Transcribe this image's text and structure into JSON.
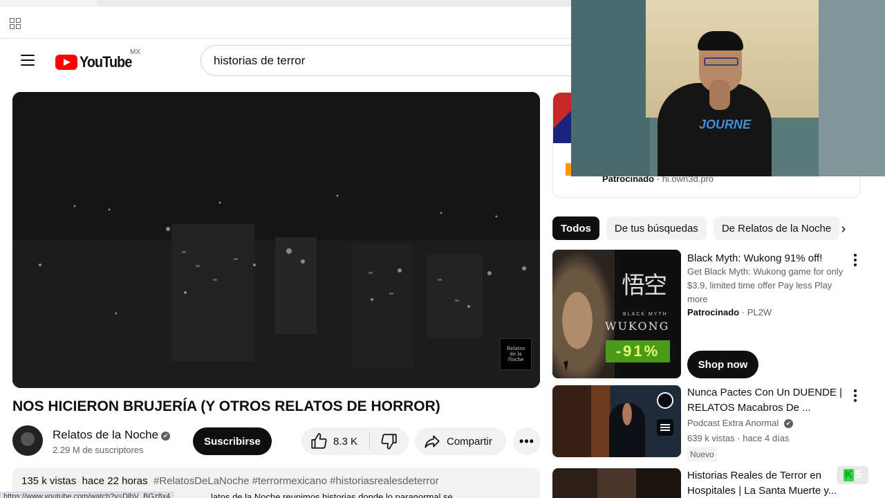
{
  "header": {
    "logo_text": "YouTube",
    "country_code": "MX",
    "search_value": "historias de terror"
  },
  "video": {
    "title": "NOS HICIERON BRUJERÍA (Y OTROS RELATOS DE HORROR)",
    "channel_name": "Relatos de la Noche",
    "verified_mark": "✔",
    "subscribers": "2.29 M de suscriptores",
    "subscribe_label": "Suscribirse",
    "likes": "8.3 K",
    "share_label": "Compartir",
    "more_label": "•••",
    "views": "135 k vistas",
    "age": "hace 22 horas",
    "hashtags": "#RelatosDeLaNoche #terrormexicano #historiasrealesdeterror",
    "status_url": "https://www.youtube.com/watch?v=DlbV_BGz8x4",
    "description_fragment": "latos de la Noche reunimos historias donde lo paranormal se"
  },
  "ad_top": {
    "sponsored_label": "Patrocinado",
    "domain": "hi.own3d.pro"
  },
  "chips": [
    {
      "label": "Todos",
      "active": true
    },
    {
      "label": "De tus búsquedas",
      "active": false
    },
    {
      "label": "De Relatos de la Noche",
      "active": false
    }
  ],
  "recommendations": {
    "ad": {
      "title": "Black Myth: Wukong 91% off!",
      "description": "Get Black Myth: Wukong game for only $3.9, limited time offer Pay less Play more",
      "sponsored_label": "Patrocinado",
      "advertiser": "PL2W",
      "cta_label": "Shop now",
      "thumb_chinese": "悟空",
      "thumb_subtitle": "BLACK MYTH",
      "thumb_name": "WUKONG",
      "thumb_discount": "-91%"
    },
    "video1": {
      "title": "Nunca Pactes Con Un DUENDE | RELATOS Macabros De ...",
      "channel": "Podcast Extra Anormal",
      "views": "639 k vistas",
      "age": "hace 4 días",
      "badge": "Nuevo"
    },
    "video2": {
      "title": "Historias Reales de Terror en Hospitales | La Santa Muerte y..."
    }
  },
  "webcam": {
    "shirt_text": "JOURNE"
  },
  "overlay_badge": {
    "k": "K",
    "number": "5"
  },
  "colors": {
    "brand_red": "#ff0000",
    "text_primary": "#0f0f0f",
    "text_secondary": "#606060",
    "chip_bg": "#f2f2f2",
    "discount_green": "#4c9a1a"
  }
}
